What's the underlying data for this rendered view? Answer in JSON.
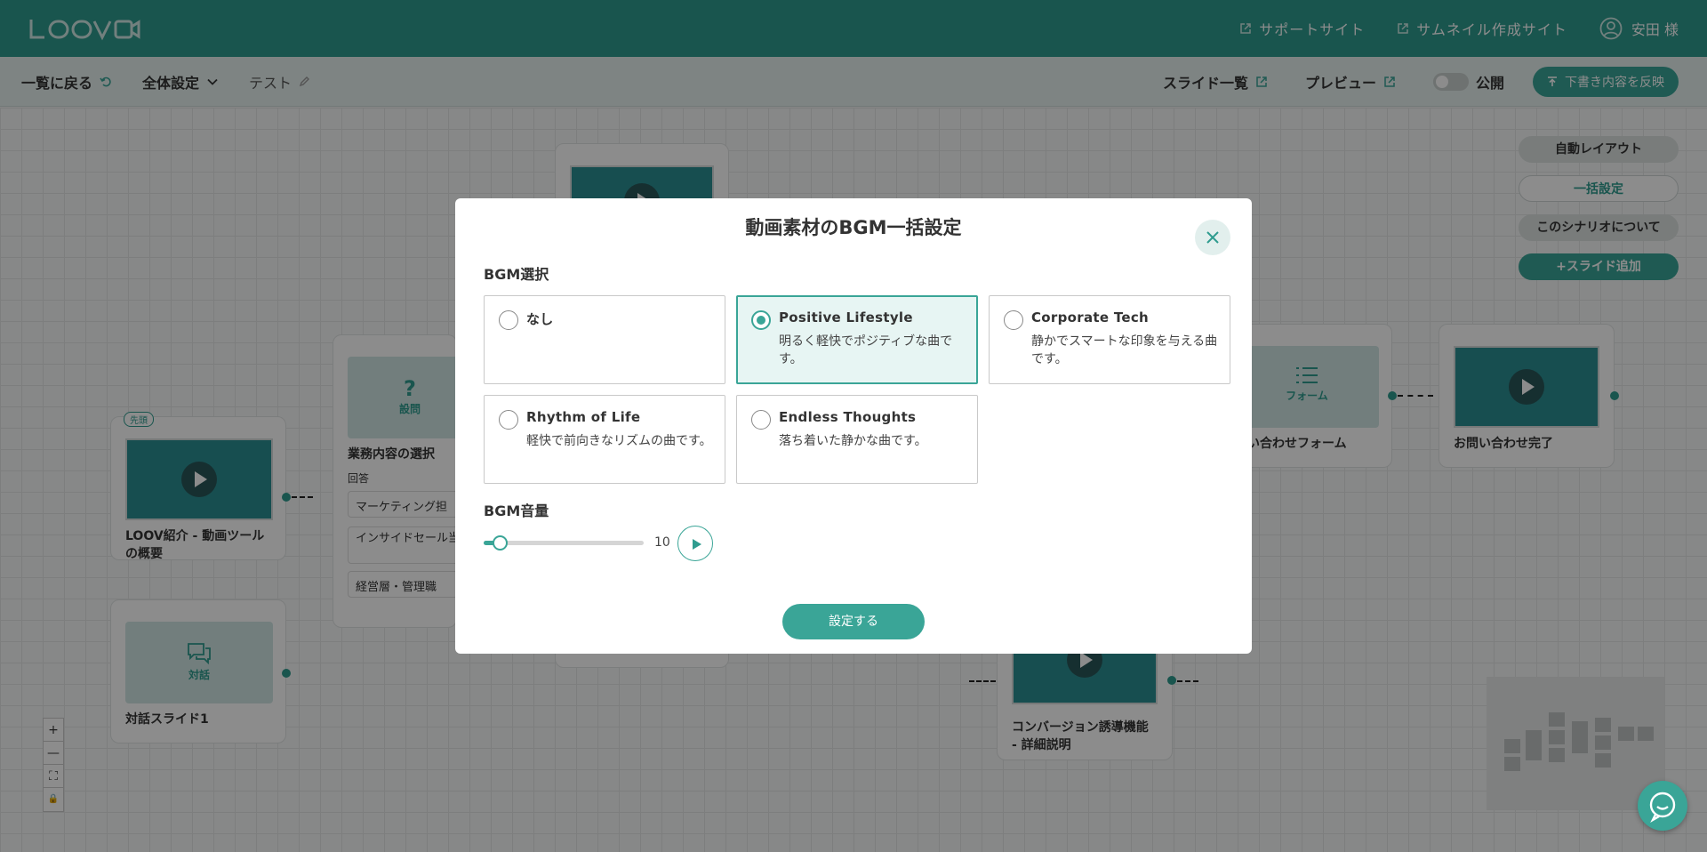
{
  "header": {
    "logo_icon": "loov-logo",
    "support_site": "サポートサイト",
    "thumbnail_site": "サムネイル作成サイト",
    "user_name": "安田 様"
  },
  "subbar": {
    "back": "一覧に戻る",
    "global_settings": "全体設定",
    "scenario_name": "テスト",
    "slide_list": "スライド一覧",
    "preview": "プレビュー",
    "publish": "公開",
    "reflect": "下書き内容を反映"
  },
  "canvas": {
    "side_buttons": {
      "auto_layout": "自動レイアウト",
      "bulk_settings": "一括設定",
      "about": "このシナリオについて",
      "add_slide": "スライド追加"
    },
    "nodes": {
      "intro": {
        "badge": "先頭",
        "title": "LOOV紹介 - 動画ツールの概要"
      },
      "question": {
        "type": "設問",
        "title": "業務内容の選択",
        "answer_label": "回答",
        "answers": [
          "マーケティング担",
          "インサイドセール当",
          "経営層・管理職"
        ]
      },
      "dialog": {
        "type": "対話",
        "title": "対話スライド1"
      },
      "form": {
        "type": "フォーム",
        "title": "問い合わせフォーム"
      },
      "complete": {
        "title": "お問い合わせ完了"
      },
      "conversion": {
        "title": "コンバージョン誘導機能 - 詳細説明"
      }
    },
    "zoom": {
      "in": "+",
      "out": "—",
      "fit": "⛶",
      "lock": "🔒"
    }
  },
  "modal": {
    "title": "動画素材のBGM一括設定",
    "bgm_label": "BGM選択",
    "options": [
      {
        "name": "なし",
        "desc": ""
      },
      {
        "name": "Positive Lifestyle",
        "desc": "明るく軽快でポジティブな曲です。"
      },
      {
        "name": "Corporate Tech",
        "desc": "静かでスマートな印象を与える曲です。"
      },
      {
        "name": "Rhythm of Life",
        "desc": "軽快で前向きなリズムの曲です。"
      },
      {
        "name": "Endless Thoughts",
        "desc": "落ち着いた静かな曲です。"
      }
    ],
    "selected_option": "Positive Lifestyle",
    "volume_label": "BGM音量",
    "volume": {
      "value": "10",
      "min": 0,
      "max": 100
    },
    "submit": "設定する"
  },
  "colors": {
    "brand": "#2f9c8f",
    "accent": "#3aa597",
    "selected_bg": "#e7f5f3"
  }
}
